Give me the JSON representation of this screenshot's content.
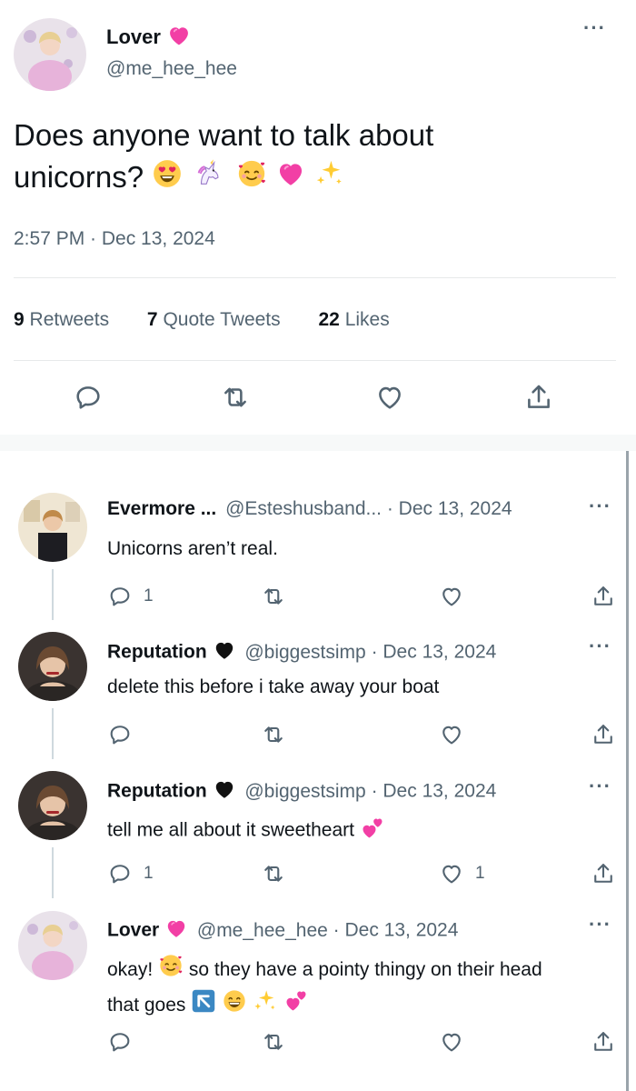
{
  "main_tweet": {
    "display_name": "Lover",
    "name_emoji": "💗",
    "handle": "@me_hee_hee",
    "text": "Does anyone want to talk about unicorns?",
    "text_line1": "Does anyone want to talk about",
    "text_line2": "unicorns?",
    "emojis": [
      "😍",
      "🦄",
      "🥰",
      "💗",
      "✨"
    ],
    "timestamp": "2:57 PM · Dec 13, 2024",
    "stats": {
      "retweets_count": "9",
      "retweets_label": "Retweets",
      "quotes_count": "7",
      "quotes_label": "Quote Tweets",
      "likes_count": "22",
      "likes_label": "Likes"
    },
    "more_icon": "more-dots-icon"
  },
  "replies": [
    {
      "display_name": "Evermore ...",
      "handle": "@Esteshusband...",
      "date": "· Dec 13, 2024",
      "text": "Unicorns aren’t real.",
      "reply_count": "1",
      "like_count": ""
    },
    {
      "display_name": "Reputation",
      "name_emoji": "🖤",
      "handle": "@biggestsimp",
      "date": "· Dec 13, 2024",
      "text": "delete this before i take away your boat",
      "reply_count": "",
      "like_count": ""
    },
    {
      "display_name": "Reputation",
      "name_emoji": "🖤",
      "handle": "@biggestsimp",
      "date": "· Dec 13, 2024",
      "text": "tell me all about it sweetheart",
      "text_emoji": "💕",
      "reply_count": "1",
      "like_count": "1"
    },
    {
      "display_name": "Lover",
      "name_emoji": "💗",
      "handle": "@me_hee_hee",
      "date": "· Dec 13, 2024",
      "text_line1": "okay!",
      "text_line1_emoji": "🥰",
      "text_line1_rest": "so they have a pointy thingy on their head",
      "text_line2": "that goes",
      "text_line2_emojis": [
        "↖️",
        "😁",
        "✨",
        "💕"
      ],
      "reply_count": "",
      "like_count": ""
    }
  ],
  "icons": {
    "reply": "reply-icon",
    "retweet": "retweet-icon",
    "like": "heart-icon",
    "share": "share-icon"
  },
  "colors": {
    "text": "#0f1419",
    "secondary": "#536471",
    "divider": "#e7e9ea",
    "heart_pink": "#f23fa5"
  }
}
